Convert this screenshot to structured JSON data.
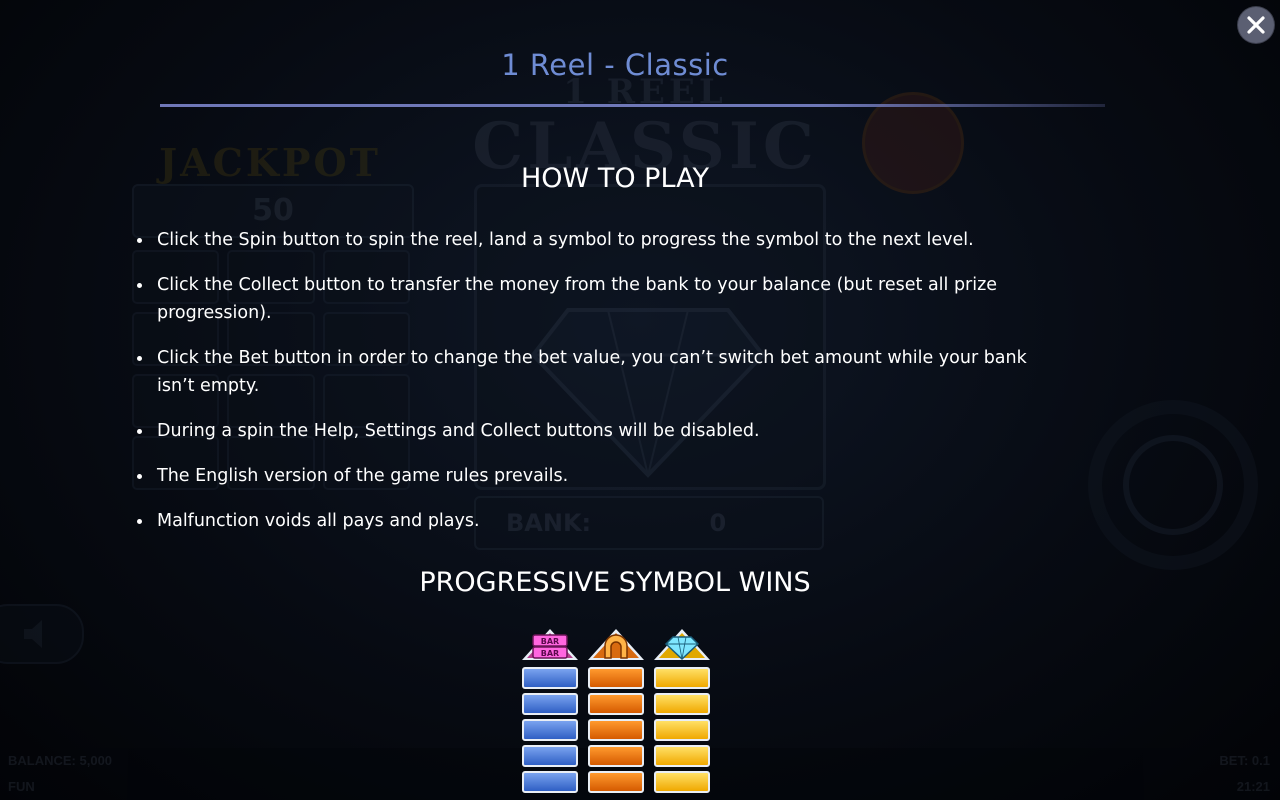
{
  "dialog": {
    "title": "1 Reel - Classic",
    "close_label": "close"
  },
  "how_to_play": {
    "heading": "HOW TO PLAY",
    "rules": [
      "Click the Spin button to spin the reel, land a symbol to progress the symbol to the next level.",
      "Click the Collect button to transfer the money from the bank to your balance (but reset all prize progression).",
      "Click the Bet button in order to change the bet value, you can’t switch bet amount while your bank isn’t empty.",
      "During a spin the Help, Settings and Collect buttons will be disabled.",
      "The English version of the game rules prevails.",
      "Malfunction voids all pays and plays."
    ]
  },
  "progressive": {
    "heading": "PROGRESSIVE SYMBOL WINS",
    "symbols": [
      {
        "name": "bar-bar-icon",
        "icon_text_top": "BAR",
        "icon_text_bottom": "BAR",
        "cell_color": "#2f5fc4"
      },
      {
        "name": "horseshoe-icon",
        "cell_color": "#d55a00"
      },
      {
        "name": "diamond-icon",
        "cell_color": "#f0a800"
      }
    ]
  },
  "background_game": {
    "logo_line1": "1 REEL",
    "logo_line2": "CLASSIC",
    "jackpot_label": "JACKPOT",
    "jackpot_value": "50",
    "bank_label": "BANK:",
    "bank_value": "0",
    "balance_label": "BALANCE: 5,000",
    "mode_label": "FUN",
    "bet_label": "BET: 0.1",
    "clock": "21:21"
  },
  "colors": {
    "title_accent": "#6f8cd4",
    "rule_line": "#6f78b8",
    "close_button": "#5b5f72"
  }
}
